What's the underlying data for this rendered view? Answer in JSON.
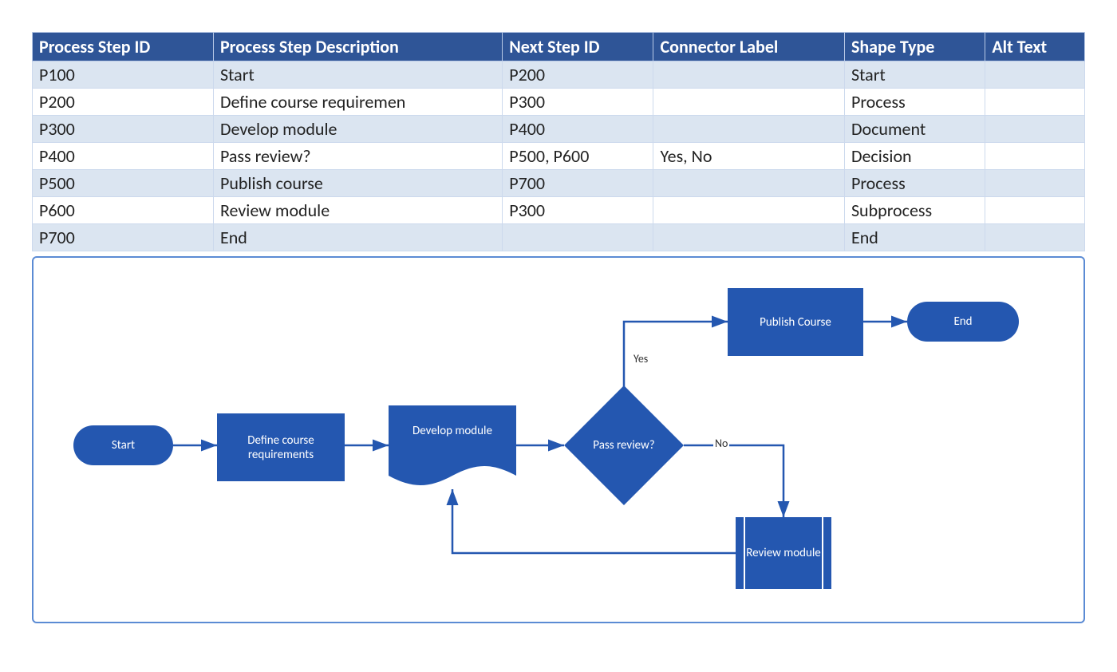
{
  "table": {
    "headers": [
      "Process Step ID",
      "Process Step Description",
      "Next Step ID",
      "Connector Label",
      "Shape Type",
      "Alt Text"
    ],
    "rows": [
      {
        "id": "P100",
        "desc": "Start",
        "next": "P200",
        "conn": "",
        "shape": "Start",
        "alt": ""
      },
      {
        "id": "P200",
        "desc": "Define course requiremen",
        "next": "P300",
        "conn": "",
        "shape": "Process",
        "alt": ""
      },
      {
        "id": "P300",
        "desc": "Develop module",
        "next": "P400",
        "conn": "",
        "shape": "Document",
        "alt": ""
      },
      {
        "id": "P400",
        "desc": "Pass review?",
        "next": "P500, P600",
        "conn": "Yes, No",
        "shape": "Decision",
        "alt": ""
      },
      {
        "id": "P500",
        "desc": "Publish course",
        "next": "P700",
        "conn": "",
        "shape": "Process",
        "alt": ""
      },
      {
        "id": "P600",
        "desc": "Review module",
        "next": "P300",
        "conn": "",
        "shape": "Subprocess",
        "alt": ""
      },
      {
        "id": "P700",
        "desc": "End",
        "next": "",
        "conn": "",
        "shape": "End",
        "alt": ""
      }
    ]
  },
  "flow": {
    "nodes": {
      "start": {
        "label": "Start"
      },
      "define": {
        "label": "Define course requirements"
      },
      "develop": {
        "label": "Develop module"
      },
      "decide": {
        "label": "Pass review?"
      },
      "publish": {
        "label": "Publish Course"
      },
      "review": {
        "label": "Review module"
      },
      "end": {
        "label": "End"
      }
    },
    "edges": {
      "yes": "Yes",
      "no": "No"
    }
  },
  "colors": {
    "header": "#2f5597",
    "shape": "#2457b0",
    "border": "#5b8bd4"
  }
}
